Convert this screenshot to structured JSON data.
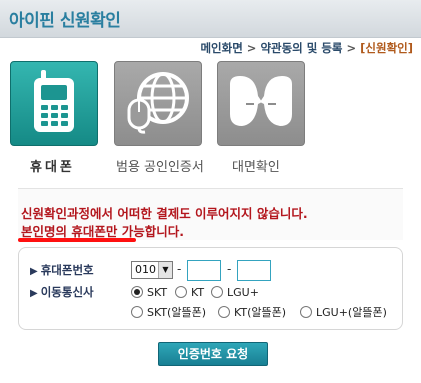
{
  "header": {
    "title": "아이핀 신원확인"
  },
  "breadcrumb": {
    "items": [
      "메인화면",
      "약관동의 및 등록",
      "[신원확인]"
    ],
    "separator": ">"
  },
  "methods": [
    {
      "label": "휴대폰",
      "icon": "mobile-phone-icon",
      "active": true
    },
    {
      "label": "범용 공인인증서",
      "icon": "globe-mouse-icon",
      "active": false
    },
    {
      "label": "대면확인",
      "icon": "face-to-face-icon",
      "active": false
    }
  ],
  "notice": {
    "line1": "신원확인과정에서 어떠한 결제도 이루어지지 않습니다.",
    "line2": "본인명의 휴대폰만 가능합니다."
  },
  "form": {
    "phone_label": "휴대폰번호",
    "carrier_label": "이동통신사",
    "prefix_value": "010",
    "dash": "-",
    "carriers": [
      {
        "label": "SKT",
        "checked": true
      },
      {
        "label": "KT",
        "checked": false
      },
      {
        "label": "LGU+",
        "checked": false
      },
      {
        "label": "SKT(알뜰폰)",
        "checked": false
      },
      {
        "label": "KT(알뜰폰)",
        "checked": false
      },
      {
        "label": "LGU+(알뜰폰)",
        "checked": false
      }
    ]
  },
  "submit_label": "인증번호 요청",
  "colors": {
    "accent_teal": "#158a86",
    "notice_red": "#b3161d",
    "title_blue": "#2a7fa0"
  }
}
